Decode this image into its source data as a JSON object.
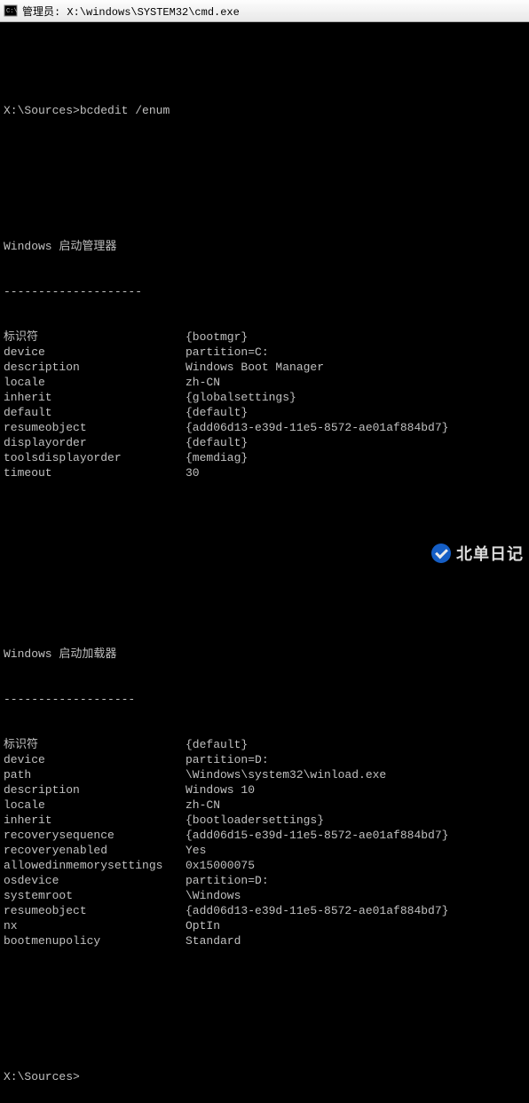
{
  "titlebar": {
    "title": "管理员: X:\\windows\\SYSTEM32\\cmd.exe"
  },
  "prompt1": {
    "path": "X:\\Sources>",
    "cmd": "bcdedit /enum"
  },
  "section1": {
    "title": "Windows 启动管理器",
    "dashes": "--------------------",
    "rows": [
      {
        "k": "标识符",
        "v": "{bootmgr}"
      },
      {
        "k": "device",
        "v": "partition=C:"
      },
      {
        "k": "description",
        "v": "Windows Boot Manager"
      },
      {
        "k": "locale",
        "v": "zh-CN"
      },
      {
        "k": "inherit",
        "v": "{globalsettings}"
      },
      {
        "k": "default",
        "v": "{default}"
      },
      {
        "k": "resumeobject",
        "v": "{add06d13-e39d-11e5-8572-ae01af884bd7}"
      },
      {
        "k": "displayorder",
        "v": "{default}"
      },
      {
        "k": "toolsdisplayorder",
        "v": "{memdiag}"
      },
      {
        "k": "timeout",
        "v": "30"
      }
    ]
  },
  "section2": {
    "title": "Windows 启动加载器",
    "dashes": "-------------------",
    "rows": [
      {
        "k": "标识符",
        "v": "{default}"
      },
      {
        "k": "device",
        "v": "partition=D:"
      },
      {
        "k": "path",
        "v": "\\Windows\\system32\\winload.exe"
      },
      {
        "k": "description",
        "v": "Windows 10"
      },
      {
        "k": "locale",
        "v": "zh-CN"
      },
      {
        "k": "inherit",
        "v": "{bootloadersettings}"
      },
      {
        "k": "recoverysequence",
        "v": "{add06d15-e39d-11e5-8572-ae01af884bd7}"
      },
      {
        "k": "recoveryenabled",
        "v": "Yes"
      },
      {
        "k": "allowedinmemorysettings",
        "v": "0x15000075"
      },
      {
        "k": "osdevice",
        "v": "partition=D:"
      },
      {
        "k": "systemroot",
        "v": "\\Windows"
      },
      {
        "k": "resumeobject",
        "v": "{add06d13-e39d-11e5-8572-ae01af884bd7}"
      },
      {
        "k": "nx",
        "v": "OptIn"
      },
      {
        "k": "bootmenupolicy",
        "v": "Standard"
      }
    ]
  },
  "prompt2": {
    "path": "X:\\Sources>"
  },
  "watermark": {
    "text": "北单日记"
  }
}
